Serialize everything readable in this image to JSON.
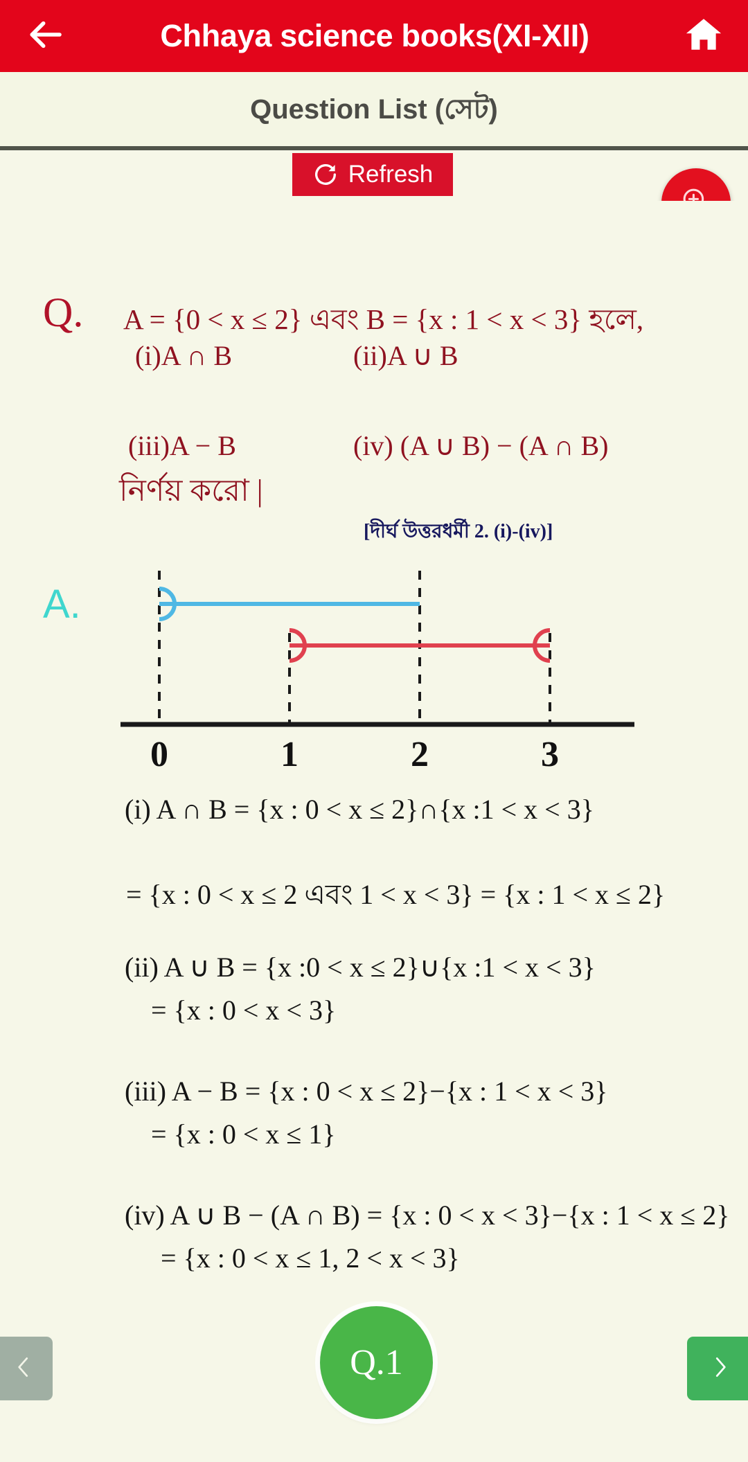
{
  "appbar": {
    "back_icon": "arrow-left-icon",
    "title": "Chhaya science books(XI-XII)",
    "home_icon": "home-icon",
    "bg_color": "#E3051B"
  },
  "subheader": {
    "title": "Question List (সেট)"
  },
  "toolbar": {
    "refresh_label": "Refresh",
    "refresh_icon": "refresh-icon",
    "refresh_color": "#D8112A",
    "zoom_fab_icon": "zoom-in-icon",
    "zoom_fab_color": "#E3101F"
  },
  "question": {
    "marker": "Q.",
    "marker_color": "#B01229",
    "line1": "A = {0 < x ≤ 2} এবং B = {x : 1 < x < 3} হলে,",
    "line2": "(i)A ∩ B",
    "line3": "(ii)A ∪ B",
    "line4": "(iii)A − B",
    "line5": "(iv) (A ∪ B) − (A ∩ B)",
    "line6": "নির্ণয় করো |",
    "reference": "[দীর্ঘ উত্তরধর্মী 2. (i)-(iv)]",
    "reference_color": "#17185E"
  },
  "answer": {
    "marker": "A.",
    "marker_color": "#3FD6CE",
    "lines": [
      "(i) A ∩ B = {x : 0 < x  ≤ 2}∩{x :1 < x < 3}",
      "= {x : 0 < x ≤ 2  এবং  1 < x < 3} = {x : 1 < x ≤ 2}",
      "(ii) A ∪ B = {x :0 < x ≤ 2}∪{x :1 < x < 3}",
      "= {x : 0 < x < 3}",
      "(iii) A − B = {x : 0 < x ≤ 2}−{x : 1 < x < 3}",
      "= {x : 0 < x ≤ 1}",
      "(iv) A ∪ B − (A ∩ B) = {x : 0 < x < 3}−{x : 1 < x ≤ 2}",
      "= {x : 0 < x ≤ 1, 2 < x < 3}"
    ]
  },
  "chart_data": {
    "type": "line",
    "title": "Number line showing sets A and B",
    "xlabel": "",
    "ylabel": "",
    "xlim": [
      -0.6,
      3.6
    ],
    "tick_values": [
      0,
      1,
      2,
      3
    ],
    "tick_labels": [
      "0",
      "1",
      "2",
      "3"
    ],
    "grid": false,
    "axis_color": "#1A1A1A",
    "dashed_guide_color": "#1A1A1A",
    "series": [
      {
        "name": "A",
        "color": "#4FB8E4",
        "start": 0,
        "end": 2,
        "start_closed": false,
        "end_closed": true,
        "notation": "0 < x ≤ 2"
      },
      {
        "name": "B",
        "color": "#E0414F",
        "start": 1,
        "end": 3,
        "start_closed": false,
        "end_closed": false,
        "notation": "1 < x < 3"
      }
    ]
  },
  "bottomnav": {
    "prev_icon": "chevron-left-icon",
    "prev_color": "#A0AFA3",
    "next_icon": "chevron-right-icon",
    "next_color": "#40B25C",
    "question_number": "Q.1",
    "badge_color": "#49B648"
  }
}
